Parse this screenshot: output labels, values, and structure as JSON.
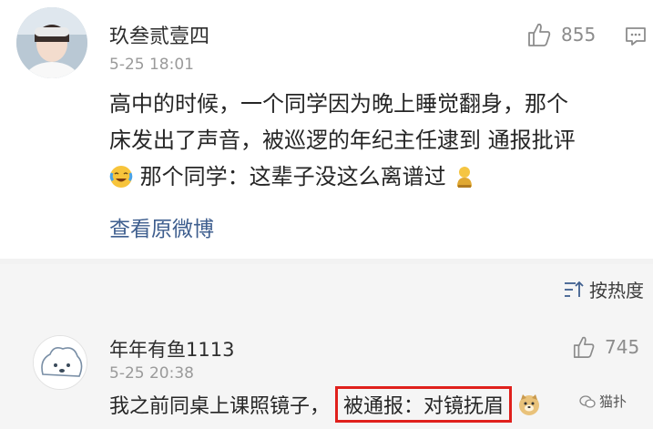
{
  "post": {
    "username": "玖叁贰壹四",
    "time": "5-25 18:01",
    "likes": "855",
    "text_lines": [
      "高中的时候，一个同学因为晚上睡觉翻身，那个",
      "床发出了声音，被巡逻的年纪主任逮到 通报批评",
      "那个同学：这辈子没这么离谱过"
    ],
    "view_original": "查看原微博",
    "icons": [
      "like-icon",
      "comment-icon",
      "laugh-cry-emoji",
      "bow-emoji"
    ]
  },
  "comments": {
    "sort_label": "按热度",
    "items": [
      {
        "username": "年年有鱼1113",
        "time": "5-25 20:38",
        "likes": "745",
        "text_prefix": "我之前同桌上课照镜子，",
        "text_highlight": "被通报：对镜抚眉"
      }
    ]
  },
  "watermark": "猫扑",
  "colors": {
    "link": "#3f5f8f",
    "highlight_border": "#e0201c",
    "comment_bg": "#f5f5f5"
  }
}
